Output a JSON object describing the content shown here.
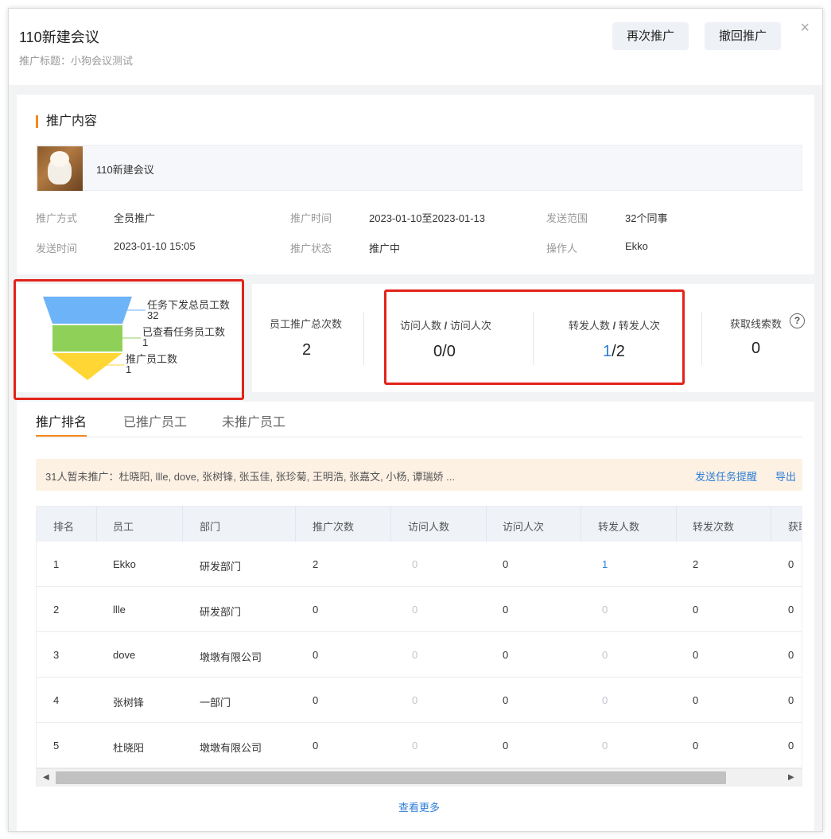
{
  "header": {
    "title": "110新建会议",
    "subtitle": "推广标题：小狗会议测试",
    "btn_repromote": "再次推广",
    "btn_withdraw": "撤回推广",
    "close": "×"
  },
  "content": {
    "section_title": "推广内容",
    "item_name": "110新建会议",
    "info": [
      {
        "label": "推广方式",
        "value": "全员推广"
      },
      {
        "label": "推广时间",
        "value": "2023-01-10至2023-01-13"
      },
      {
        "label": "发送范围",
        "value": "32个同事"
      },
      {
        "label": "发送时间",
        "value": "2023-01-10 15:05"
      },
      {
        "label": "推广状态",
        "value": "推广中"
      },
      {
        "label": "操作人",
        "value": "Ekko"
      }
    ]
  },
  "funnel": {
    "chart_data": {
      "type": "funnel",
      "categories": [
        "任务下发总员工数",
        "已查看任务员工数",
        "推广员工数"
      ],
      "values": [
        32,
        1,
        1
      ],
      "colors": [
        "#6db3f8",
        "#8fd158",
        "#ffd633"
      ]
    }
  },
  "stats": {
    "total_promotions_label": "员工推广总次数",
    "total_promotions_value": "2",
    "visit_label_a": "访问人数",
    "visit_label_b": "访问人次",
    "visit_people": "0",
    "visit_times": "0",
    "forward_label_a": "转发人数",
    "forward_label_b": "转发人次",
    "forward_people": "1",
    "forward_times": "2",
    "slash": "/",
    "leads_label": "获取线索数",
    "leads_value": "0",
    "help_icon": "?"
  },
  "tabs": [
    "推广排名",
    "已推广员工",
    "未推广员工"
  ],
  "notice": {
    "text": "31人暂未推广：杜晓阳, llle, dove, 张树锋, 张玉佳, 张珍菊, 王明浩, 张嘉文, 小杨, 谭瑞娇 ...",
    "send_reminder": "发送任务提醒",
    "export": "导出"
  },
  "table": {
    "headers": [
      "排名",
      "员工",
      "部门",
      "推广次数",
      "访问人数",
      "访问人次",
      "转发人数",
      "转发次数",
      "获取线索数"
    ],
    "rows": [
      [
        "1",
        "Ekko",
        "研发部门",
        "2",
        "0",
        "0",
        "1",
        "2",
        "0"
      ],
      [
        "2",
        "llle",
        "研发部门",
        "0",
        "0",
        "0",
        "0",
        "0",
        "0"
      ],
      [
        "3",
        "dove",
        "墩墩有限公司",
        "0",
        "0",
        "0",
        "0",
        "0",
        "0"
      ],
      [
        "4",
        "张树锋",
        "一部门",
        "0",
        "0",
        "0",
        "0",
        "0",
        "0"
      ],
      [
        "5",
        "杜晓阳",
        "墩墩有限公司",
        "0",
        "0",
        "0",
        "0",
        "0",
        "0"
      ]
    ],
    "more": "查看更多"
  }
}
